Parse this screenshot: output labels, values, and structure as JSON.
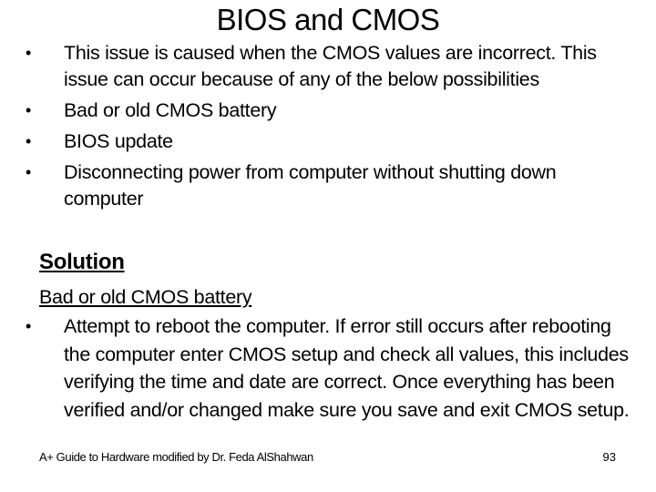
{
  "slide": {
    "title": "BIOS and CMOS",
    "bullets": [
      "This issue is caused when the CMOS values are incorrect. This issue can occur because of any of the below possibilities",
      "Bad or old CMOS battery",
      "BIOS update",
      "Disconnecting power from computer without shutting down computer"
    ],
    "bullet_glyph": "•",
    "solution_heading": "Solution",
    "solution_subheading": "Bad or old CMOS battery",
    "solution_bullets": [
      "Attempt to reboot the computer. If error still occurs after rebooting the computer enter CMOS setup and check all values, this includes verifying the time and date are correct. Once everything has been verified and/or changed make sure you save and exit CMOS setup."
    ],
    "footer": "A+ Guide to Hardware modified by Dr. Feda AlShahwan",
    "page_number": "93"
  }
}
